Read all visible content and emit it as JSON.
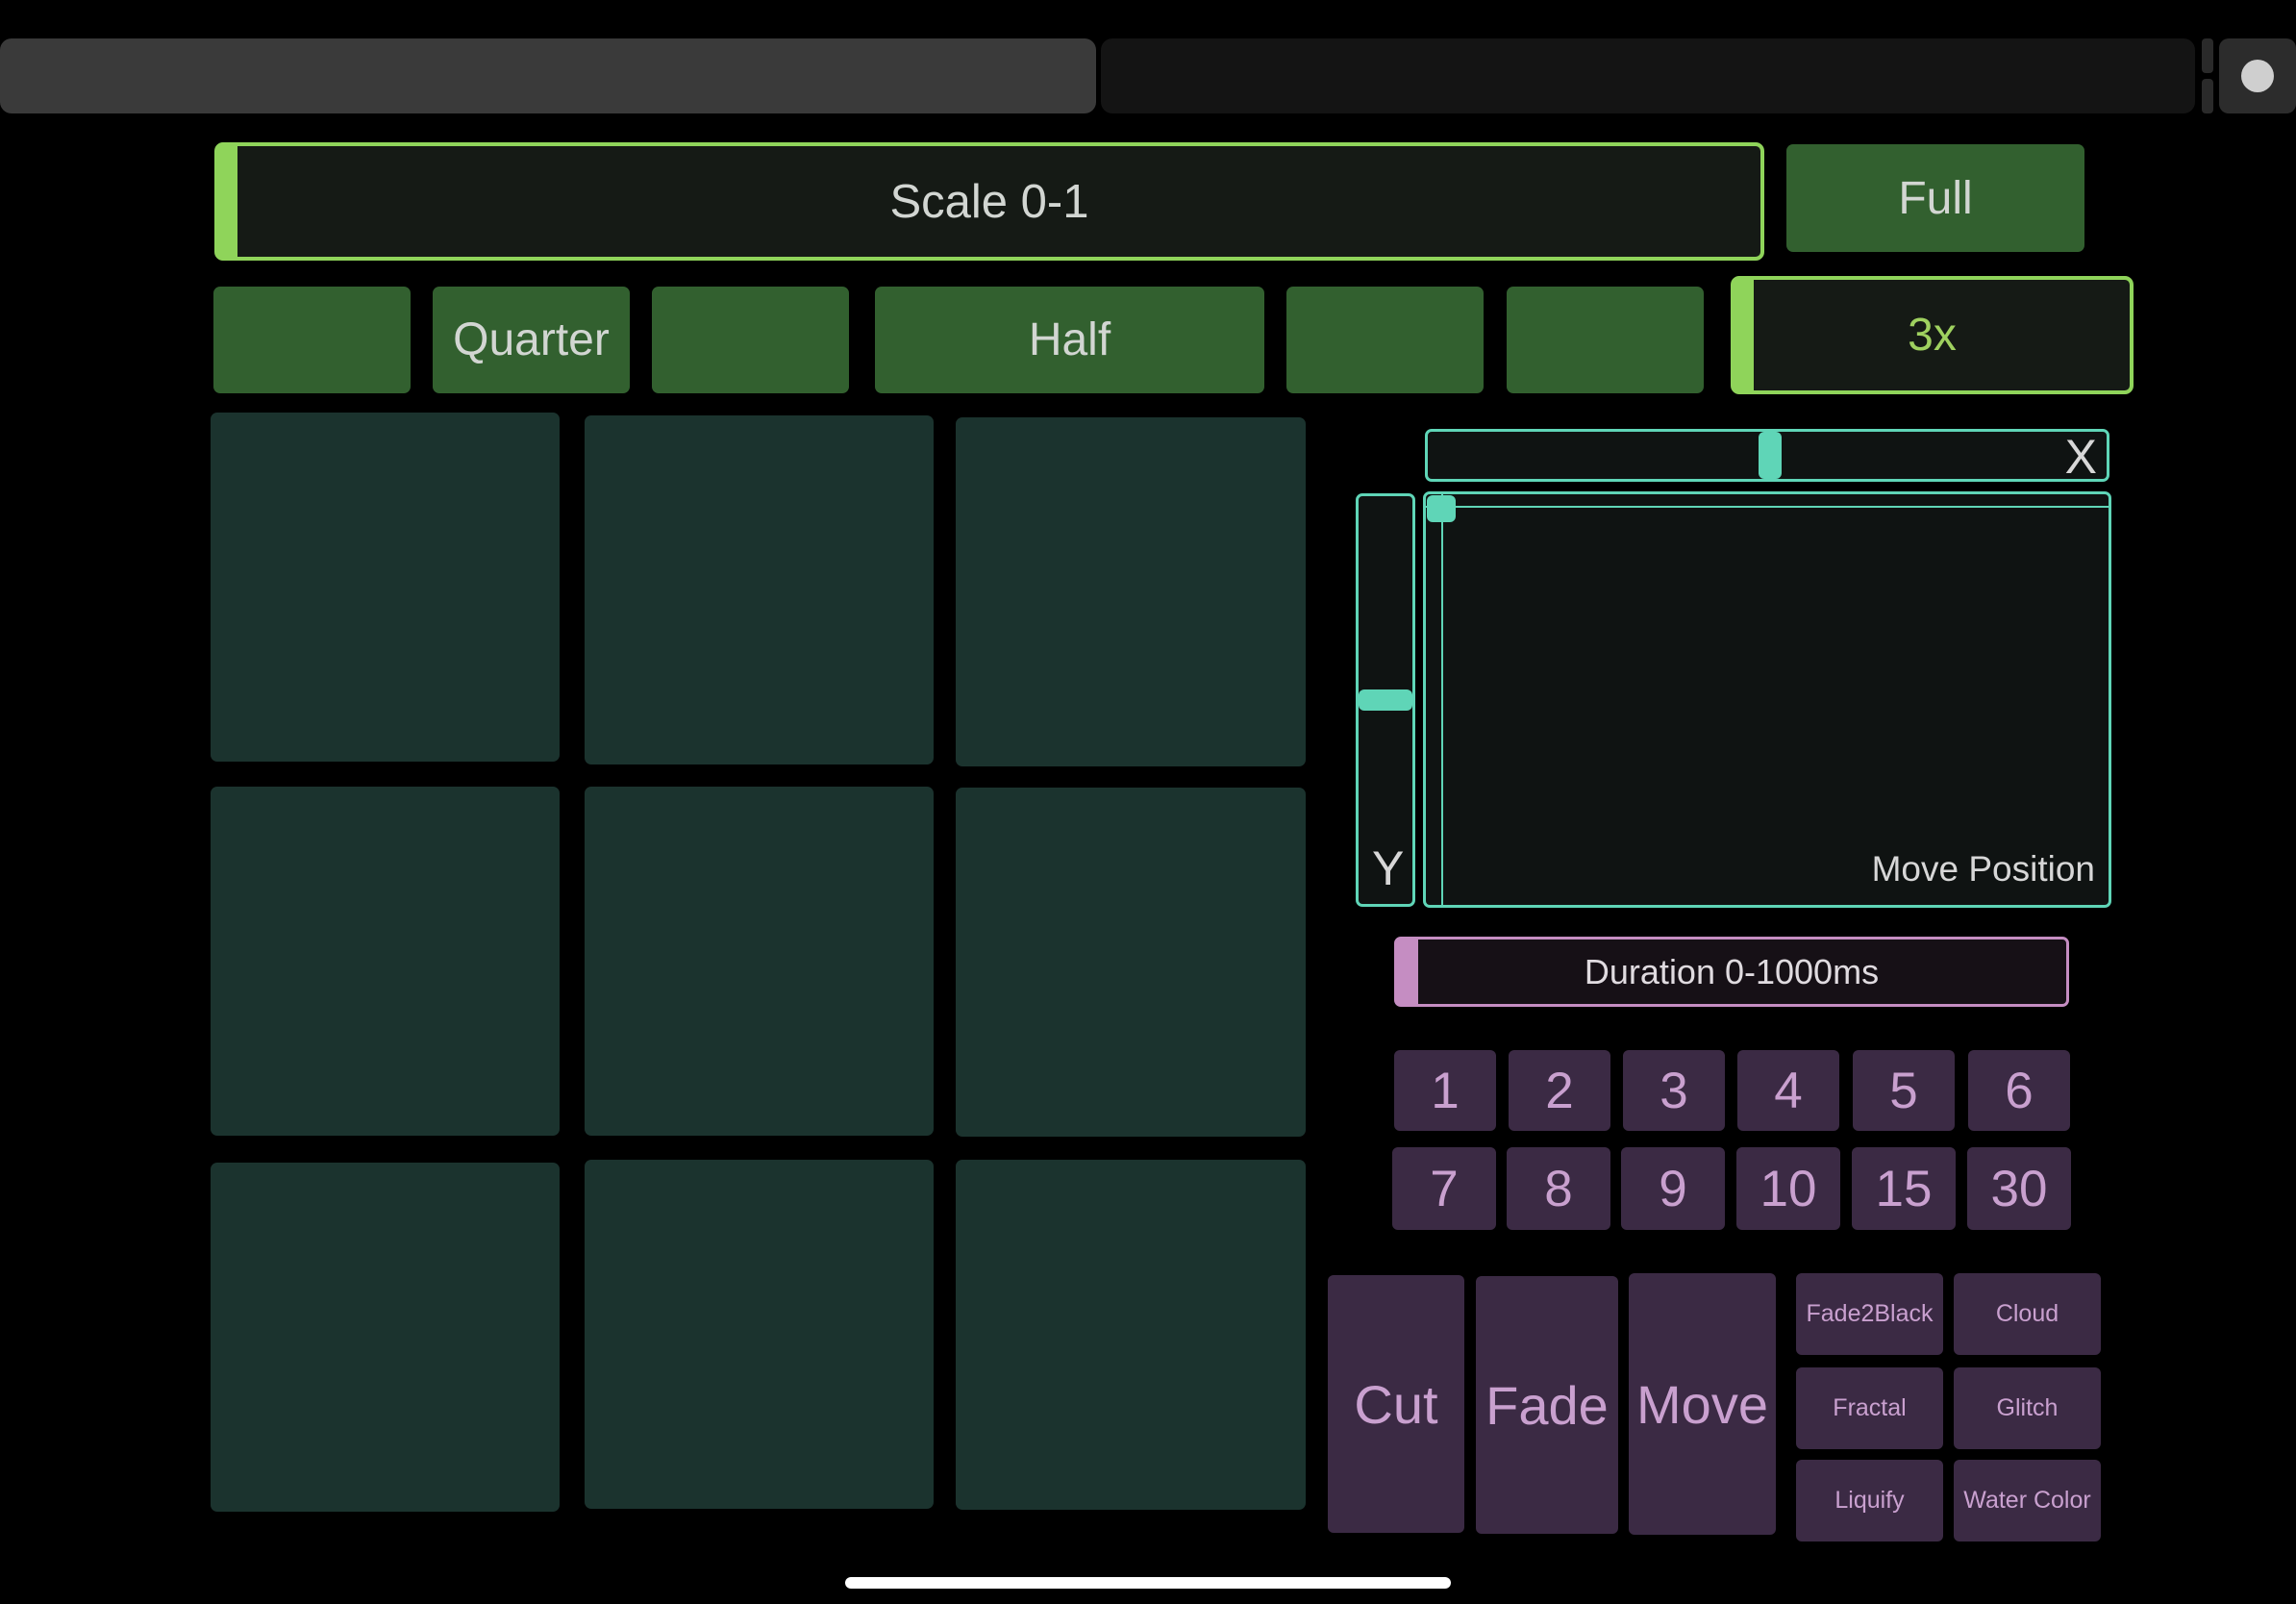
{
  "colors": {
    "green_accent": "#8fd45a",
    "green_button": "#32602f",
    "pad": "#1b332e",
    "teal_accent": "#5fd5b7",
    "purple_accent": "#c58dc2",
    "purple_button": "#3b2a44"
  },
  "top_bar": {
    "settings_icon": "dot-icon"
  },
  "scale": {
    "label": "Scale 0-1",
    "value": 0.01,
    "full_label": "Full",
    "presets": [
      "",
      "Quarter",
      "",
      "Half",
      "",
      ""
    ]
  },
  "multiplier": {
    "label": "3x",
    "value": 0.01
  },
  "pads": {
    "count": 9
  },
  "xy_pad": {
    "x_label": "X",
    "y_label": "Y",
    "pad_label": "Move Position",
    "x_value": 0.5,
    "y_value": 0.5
  },
  "duration": {
    "label": "Duration 0-1000ms",
    "value": 0.02
  },
  "number_buttons": [
    "1",
    "2",
    "3",
    "4",
    "5",
    "6",
    "7",
    "8",
    "9",
    "10",
    "15",
    "30"
  ],
  "transitions": {
    "cut_label": "Cut",
    "fade_label": "Fade",
    "move_label": "Move",
    "effects": [
      "Fade2Black",
      "Cloud",
      "Fractal",
      "Glitch",
      "Liquify",
      "Water Color"
    ]
  }
}
